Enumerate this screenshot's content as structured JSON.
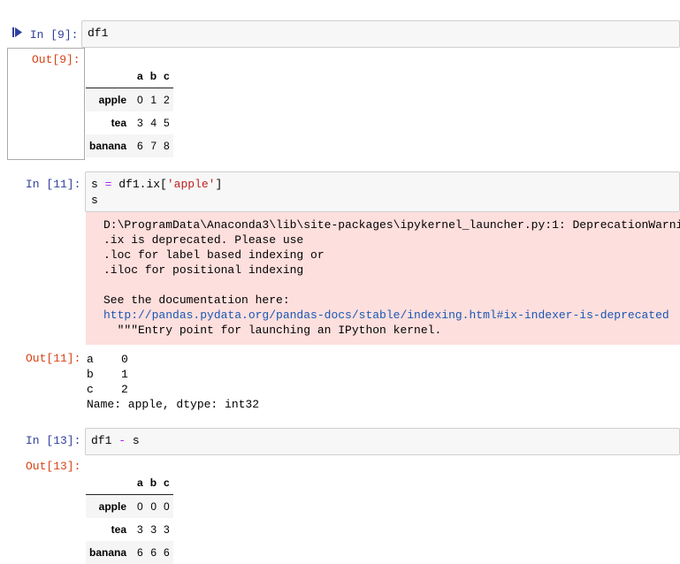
{
  "cells": [
    {
      "in_prompt": "In  [9]:",
      "code": "df1",
      "out_prompt": "Out[9]:",
      "table": {
        "columns": [
          "a",
          "b",
          "c"
        ],
        "rows": [
          {
            "index": "apple",
            "values": [
              "0",
              "1",
              "2"
            ]
          },
          {
            "index": "tea",
            "values": [
              "3",
              "4",
              "5"
            ]
          },
          {
            "index": "banana",
            "values": [
              "6",
              "7",
              "8"
            ]
          }
        ]
      }
    },
    {
      "in_prompt": "In  [11]:",
      "code_line1_var": "s",
      "code_line1_eq": "=",
      "code_line1_expr": "df1.ix[",
      "code_line1_str": "'apple'",
      "code_line1_close": "]",
      "code_line2": "s",
      "stderr": {
        "line1": "D:\\ProgramData\\Anaconda3\\lib\\site-packages\\ipykernel_launcher.py:1: DeprecationWarning:",
        "line2": ".ix is deprecated. Please use",
        "line3": ".loc for label based indexing or",
        "line4": ".iloc for positional indexing",
        "line5": "",
        "line6": "See the documentation here:",
        "link": "http://pandas.pydata.org/pandas-docs/stable/indexing.html#ix-indexer-is-deprecated",
        "line8": "  \"\"\"Entry point for launching an IPython kernel."
      },
      "out_prompt": "Out[11]:",
      "series_output": {
        "line1": "a    0",
        "line2": "b    1",
        "line3": "c    2",
        "line4": "Name: apple, dtype: int32"
      }
    },
    {
      "in_prompt": "In  [13]:",
      "code_left": "df1",
      "code_op": "-",
      "code_right": "s",
      "out_prompt": "Out[13]:",
      "table": {
        "columns": [
          "a",
          "b",
          "c"
        ],
        "rows": [
          {
            "index": "apple",
            "values": [
              "0",
              "0",
              "0"
            ]
          },
          {
            "index": "tea",
            "values": [
              "3",
              "3",
              "3"
            ]
          },
          {
            "index": "banana",
            "values": [
              "6",
              "6",
              "6"
            ]
          }
        ]
      }
    }
  ],
  "colors": {
    "in_prompt": "#303f9f",
    "out_prompt": "#d84315",
    "stderr_bg": "#fddfdd",
    "link": "#1a56b6",
    "keyword_op": "#aa22ff",
    "string": "#ba2121"
  },
  "icons": {
    "run": "run-cell-icon"
  }
}
